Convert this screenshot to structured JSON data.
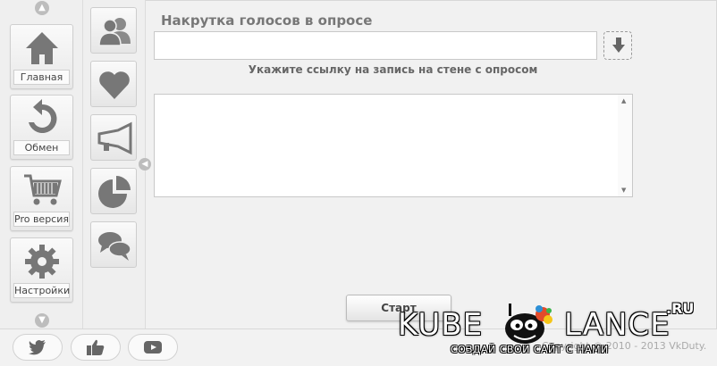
{
  "nav": {
    "items": [
      {
        "label": "Главная",
        "icon": "home-icon"
      },
      {
        "label": "Обмен",
        "icon": "refresh-icon"
      },
      {
        "label": "Pro версия",
        "icon": "cart-icon"
      },
      {
        "label": "Настройки",
        "icon": "gear-icon"
      }
    ]
  },
  "subnav": {
    "icons": [
      "users-icon",
      "heart-icon",
      "megaphone-icon",
      "pie-chart-icon",
      "chat-icon"
    ]
  },
  "main": {
    "title": "Накрутка голосов в опросе",
    "url_value": "",
    "hint": "Укажите ссылку на запись на стене с опросом",
    "output_value": "",
    "start_label": "Старт"
  },
  "footer": {
    "copyright": "Copyright © 2010 - 2013 VkDuty.",
    "social": [
      "twitter-icon",
      "like-icon",
      "youtube-icon"
    ]
  },
  "watermark": {
    "kube": "KUBE",
    "lance": "LANCE",
    "ru": ".RU",
    "tagline": "СОЗДАЙ СВОЙ САЙТ С НАМИ"
  },
  "colors": {
    "icon_gray": "#777777",
    "background": "#f1f1f1"
  }
}
